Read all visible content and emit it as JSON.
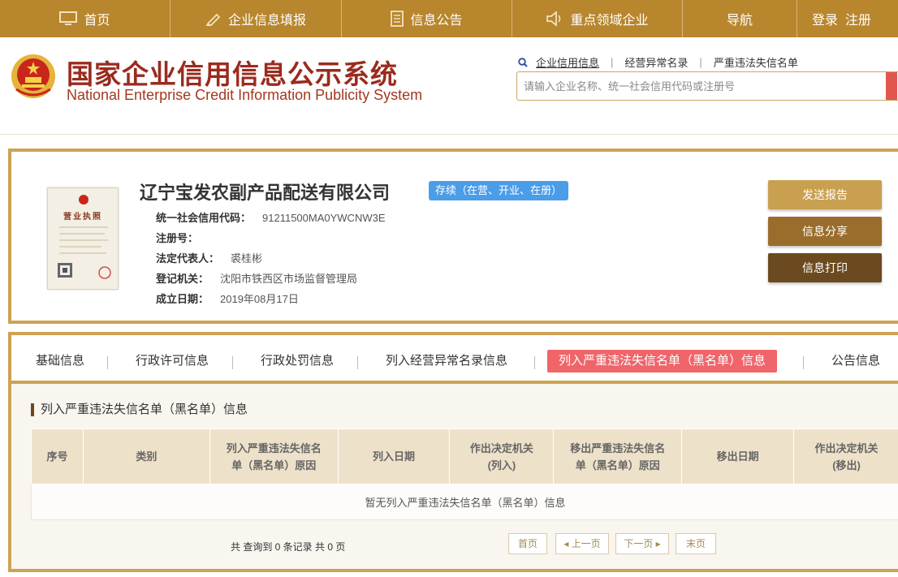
{
  "nav": {
    "items": [
      {
        "label": "首页",
        "icon": "monitor-icon"
      },
      {
        "label": "企业信息填报",
        "icon": "pen-icon"
      },
      {
        "label": "信息公告",
        "icon": "document-icon"
      },
      {
        "label": "重点领域企业",
        "icon": "speaker-icon"
      },
      {
        "label": "导航",
        "icon": ""
      },
      {
        "label": "登录  注册",
        "icon": ""
      }
    ]
  },
  "header": {
    "title_cn": "国家企业信用信息公示系统",
    "title_en": "National Enterprise Credit Information Publicity System",
    "search_links": [
      "企业信用信息",
      "经营异常名录",
      "严重违法失信名单"
    ],
    "search_placeholder": "请输入企业名称、统一社会信用代码或注册号"
  },
  "company": {
    "license_title": "营业执照",
    "name": "辽宁宝发农副产品配送有限公司",
    "status": "存续（在营、开业、在册）",
    "fields": [
      {
        "label": "统一社会信用代码：",
        "value": "91211500MA0YWCNW3E"
      },
      {
        "label": "注册号：",
        "value": ""
      },
      {
        "label": "法定代表人：",
        "value": "裘桂彬"
      },
      {
        "label": "登记机关：",
        "value": "沈阳市铁西区市场监督管理局"
      },
      {
        "label": "成立日期：",
        "value": "2019年08月17日"
      }
    ],
    "actions": [
      "发送报告",
      "信息分享",
      "信息打印"
    ]
  },
  "tabs": {
    "items": [
      "基础信息",
      "行政许可信息",
      "行政处罚信息",
      "列入经营异常名录信息",
      "列入严重违法失信名单（黑名单）信息",
      "公告信息"
    ],
    "active_index": 4
  },
  "panel": {
    "heading": "列入严重违法失信名单（黑名单）信息",
    "columns": [
      {
        "line1": "序号",
        "line2": ""
      },
      {
        "line1": "类别",
        "line2": ""
      },
      {
        "line1": "列入严重违法失信名",
        "line2": "单（黑名单）原因"
      },
      {
        "line1": "列入日期",
        "line2": ""
      },
      {
        "line1": "作出决定机关",
        "line2": "(列入)"
      },
      {
        "line1": "移出严重违法失信名",
        "line2": "单（黑名单）原因"
      },
      {
        "line1": "移出日期",
        "line2": ""
      },
      {
        "line1": "作出决定机关",
        "line2": "(移出)"
      }
    ],
    "empty_text": "暂无列入严重违法失信名单（黑名单）信息",
    "pager": {
      "summary": "共 查询到 0 条记录 共 0 页",
      "first": "首页",
      "prev": "上一页",
      "next": "下一页",
      "last": "末页"
    }
  },
  "colors": {
    "nav_bg": "#b8862c",
    "brand_red": "#9a2b1e",
    "card_border": "#cda353",
    "status_blue": "#4b9de8",
    "active_tab": "#f0656a",
    "btn_send": "#c9a04f",
    "btn_share": "#9a6d2c",
    "btn_print": "#6b4a1f"
  }
}
